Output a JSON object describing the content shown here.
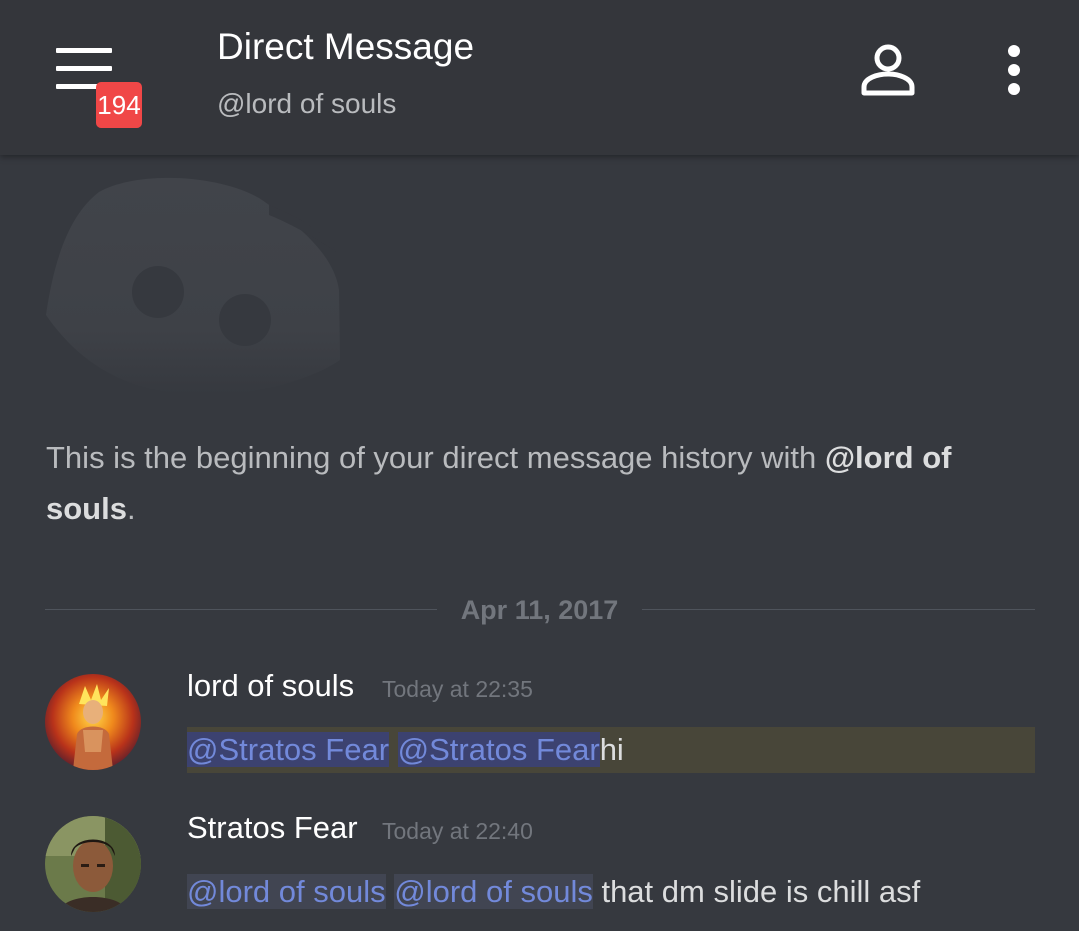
{
  "header": {
    "title": "Direct Message",
    "subtitle": "@lord of souls",
    "unread_badge": "194",
    "menu_icon": "hamburger-menu-icon",
    "profile_icon": "user-profile-icon",
    "more_icon": "more-vertical-icon"
  },
  "intro": {
    "logo_icon": "discord-logo-icon",
    "text_prefix": "This is the beginning of your direct message history with ",
    "username": "@lord of souls",
    "text_suffix": "."
  },
  "divider": {
    "date": "Apr 11, 2017"
  },
  "messages": [
    {
      "author": "lord of souls",
      "time": "Today at 22:35",
      "mention1": "@Stratos Fear",
      "mention2": "@Stratos Fear",
      "text": "hi",
      "highlighted": true
    },
    {
      "author": "Stratos Fear",
      "time": "Today at 22:40",
      "mention1": "@lord of souls",
      "mention2": "@lord of souls",
      "text": " that dm slide is chill asf",
      "highlighted": false
    }
  ],
  "colors": {
    "background": "#36393f",
    "header": "#34363b",
    "badge": "#f04747",
    "mention": "#7289da",
    "highlight": "#484639"
  }
}
